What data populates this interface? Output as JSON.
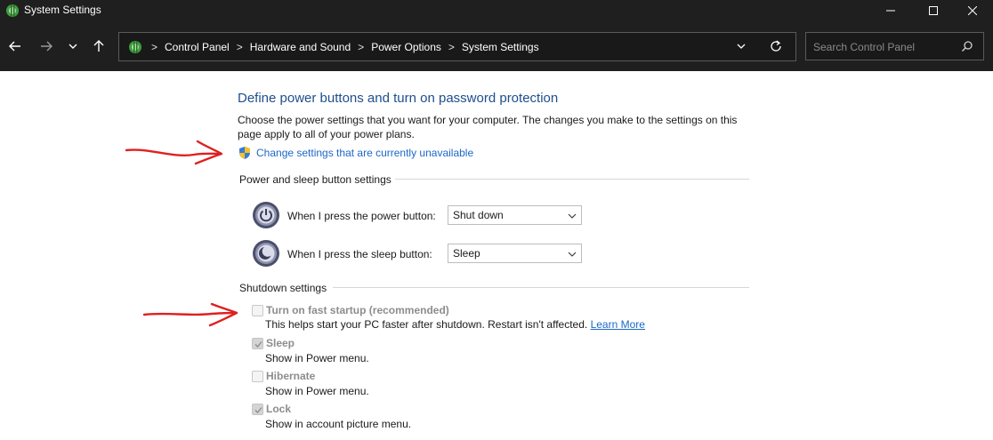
{
  "window": {
    "title": "System Settings",
    "icon": "control-panel-icon"
  },
  "nav": {
    "back_icon": "arrow-left-icon",
    "forward_icon": "arrow-right-icon",
    "recent_icon": "chevron-down-icon",
    "up_icon": "arrow-up-icon"
  },
  "breadcrumb": {
    "items": [
      "Control Panel",
      "Hardware and Sound",
      "Power Options",
      "System Settings"
    ],
    "separator": ">"
  },
  "search": {
    "placeholder": "Search Control Panel",
    "value": ""
  },
  "main": {
    "heading": "Define power buttons and turn on password protection",
    "description": "Choose the power settings that you want for your computer. The changes you make to the settings on this page apply to all of your power plans.",
    "change_link": "Change settings that are currently unavailable"
  },
  "power_buttons": {
    "group_title": "Power and sleep button settings",
    "power_label": "When I press the power button:",
    "power_value": "Shut down",
    "sleep_label": "When I press the sleep button:",
    "sleep_value": "Sleep"
  },
  "shutdown": {
    "group_title": "Shutdown settings",
    "options": [
      {
        "title": "Turn on fast startup (recommended)",
        "desc": "This helps start your PC faster after shutdown. Restart isn't affected.",
        "link": "Learn More",
        "checked": false
      },
      {
        "title": "Sleep",
        "desc": "Show in Power menu.",
        "checked": true
      },
      {
        "title": "Hibernate",
        "desc": "Show in Power menu.",
        "checked": false
      },
      {
        "title": "Lock",
        "desc": "Show in account picture menu.",
        "checked": true
      }
    ]
  },
  "colors": {
    "titlebar_bg": "#1f1f1f",
    "heading": "#1e4e8c",
    "link": "#1b68c6",
    "annotation": "#e02020"
  }
}
